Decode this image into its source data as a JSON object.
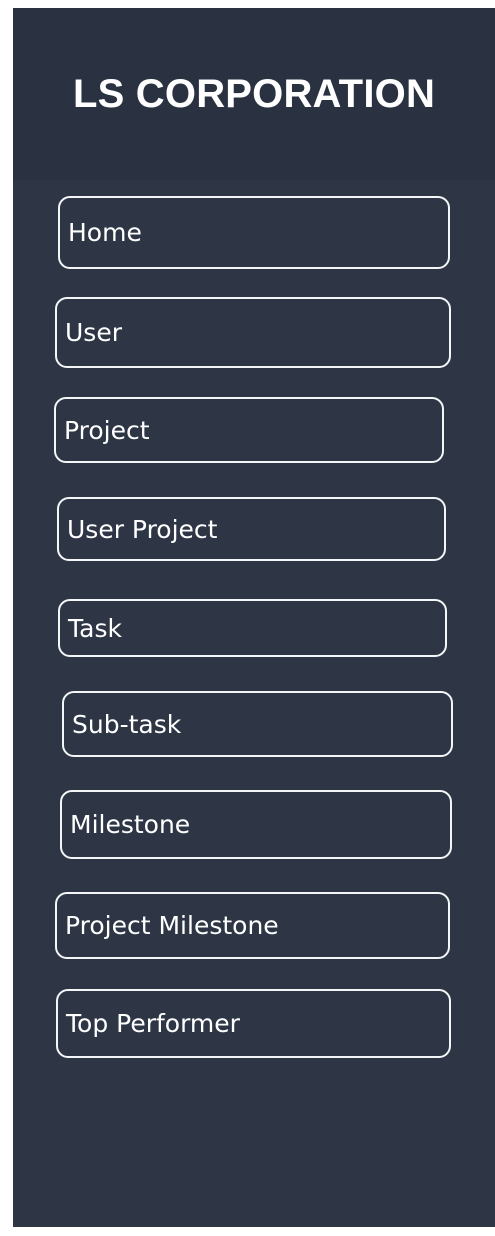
{
  "brand": {
    "title": "LS CORPORATION"
  },
  "sidebar": {
    "items": [
      {
        "label": "Home"
      },
      {
        "label": "User"
      },
      {
        "label": "Project"
      },
      {
        "label": "User Project"
      },
      {
        "label": "Task"
      },
      {
        "label": "Sub-task"
      },
      {
        "label": "Milestone"
      },
      {
        "label": "Project Milestone"
      },
      {
        "label": "Top Performer"
      }
    ]
  },
  "colors": {
    "sidebar_bg": "#2e3646",
    "header_bg": "#2a3242",
    "item_border": "#f4f6f8",
    "text": "#ffffff"
  }
}
